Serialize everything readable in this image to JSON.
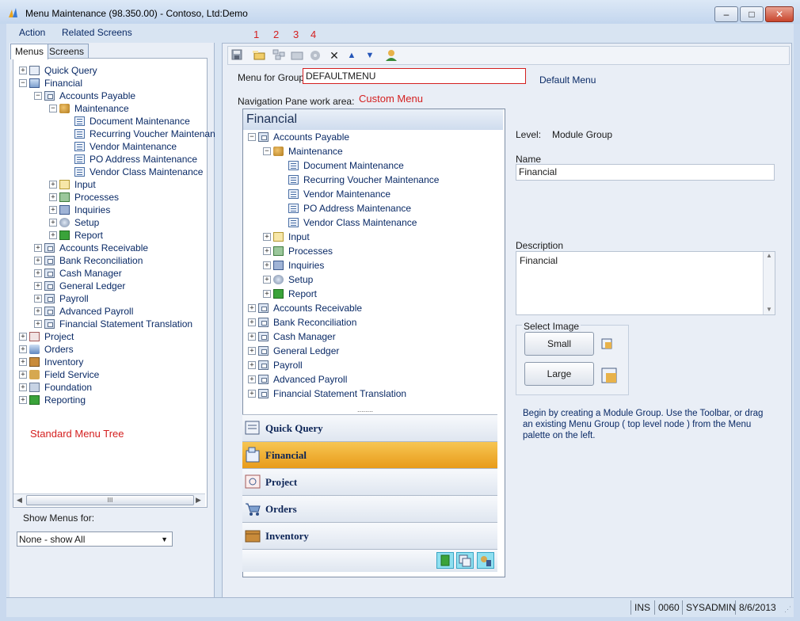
{
  "window": {
    "title": "Menu Maintenance (98.350.00) - Contoso, Ltd:Demo",
    "controls": {
      "minimize": "–",
      "maximize": "□",
      "close": "✕"
    }
  },
  "menubar": {
    "items": [
      "Action",
      "Related Screens"
    ]
  },
  "left": {
    "tabs": [
      "Menus",
      "Screens"
    ],
    "tree": [
      {
        "label": "Quick Query",
        "expander": "+"
      },
      {
        "label": "Financial",
        "expander": "−"
      },
      {
        "label": "Accounts Payable",
        "expander": "−"
      },
      {
        "label": "Maintenance",
        "expander": "−"
      },
      {
        "label": "Document Maintenance"
      },
      {
        "label": "Recurring Voucher Maintenan"
      },
      {
        "label": "Vendor Maintenance"
      },
      {
        "label": "PO Address Maintenance"
      },
      {
        "label": "Vendor Class Maintenance"
      },
      {
        "label": "Input",
        "expander": "+"
      },
      {
        "label": "Processes",
        "expander": "+"
      },
      {
        "label": "Inquiries",
        "expander": "+"
      },
      {
        "label": "Setup",
        "expander": "+"
      },
      {
        "label": "Report",
        "expander": "+"
      },
      {
        "label": "Accounts Receivable",
        "expander": "+"
      },
      {
        "label": "Bank Reconciliation",
        "expander": "+"
      },
      {
        "label": "Cash Manager",
        "expander": "+"
      },
      {
        "label": "General Ledger",
        "expander": "+"
      },
      {
        "label": "Payroll",
        "expander": "+"
      },
      {
        "label": "Advanced Payroll",
        "expander": "+"
      },
      {
        "label": "Financial Statement Translation",
        "expander": "+"
      },
      {
        "label": "Project",
        "expander": "+"
      },
      {
        "label": "Orders",
        "expander": "+"
      },
      {
        "label": "Inventory",
        "expander": "+"
      },
      {
        "label": "Field Service",
        "expander": "+"
      },
      {
        "label": "Foundation",
        "expander": "+"
      },
      {
        "label": "Reporting",
        "expander": "+"
      }
    ],
    "annotation": "Standard Menu Tree",
    "scroll_grip": "III",
    "show_menus_label": "Show Menus for:",
    "show_menus_value": "None - show All"
  },
  "toolbar": {
    "numbers": [
      "1",
      "2",
      "3",
      "4"
    ],
    "icons": [
      "save-icon",
      "new-group-icon",
      "new-menu-icon",
      "new-folder-icon",
      "copy-icon",
      "delete-icon",
      "move-up-icon",
      "move-down-icon",
      "user-icon"
    ]
  },
  "form": {
    "menu_for_group_label": "Menu for Group:",
    "menu_for_group_value": "DEFAULTMENU",
    "menu_for_group_desc": "Default Menu",
    "nav_pane_label": "Navigation Pane work area:",
    "custom_menu_annotation": "Custom Menu",
    "level_label": "Level:",
    "level_value": "Module Group",
    "name_label": "Name",
    "name_value": "Financial",
    "description_label": "Description",
    "description_value": "Financial",
    "select_image_label": "Select Image",
    "small_button": "Small",
    "large_button": "Large",
    "help_text": "Begin by creating a Module Group. Use the Toolbar, or drag an existing Menu Group ( top level node ) from the Menu palette on the left."
  },
  "nav_pane": {
    "header": "Financial",
    "tree": [
      {
        "label": "Accounts Payable",
        "expander": "−"
      },
      {
        "label": "Maintenance",
        "expander": "−"
      },
      {
        "label": "Document Maintenance"
      },
      {
        "label": "Recurring Voucher Maintenance"
      },
      {
        "label": "Vendor Maintenance"
      },
      {
        "label": "PO Address Maintenance"
      },
      {
        "label": "Vendor Class Maintenance"
      },
      {
        "label": "Input",
        "expander": "+"
      },
      {
        "label": "Processes",
        "expander": "+"
      },
      {
        "label": "Inquiries",
        "expander": "+"
      },
      {
        "label": "Setup",
        "expander": "+"
      },
      {
        "label": "Report",
        "expander": "+"
      },
      {
        "label": "Accounts Receivable",
        "expander": "+"
      },
      {
        "label": "Bank Reconciliation",
        "expander": "+"
      },
      {
        "label": "Cash Manager",
        "expander": "+"
      },
      {
        "label": "General Ledger",
        "expander": "+"
      },
      {
        "label": "Payroll",
        "expander": "+"
      },
      {
        "label": "Advanced Payroll",
        "expander": "+"
      },
      {
        "label": "Financial Statement Translation",
        "expander": "+"
      }
    ],
    "splitter": "........",
    "buttons": [
      {
        "label": "Quick Query",
        "icon": "quick-query-icon"
      },
      {
        "label": "Financial",
        "icon": "financial-icon",
        "selected": true
      },
      {
        "label": "Project",
        "icon": "project-icon"
      },
      {
        "label": "Orders",
        "icon": "orders-icon"
      },
      {
        "label": "Inventory",
        "icon": "inventory-icon"
      }
    ],
    "overflow_icons": [
      "report-icon",
      "copy-icon",
      "field-service-icon"
    ]
  },
  "statusbar": {
    "ins": "INS",
    "code": "0060",
    "user": "SYSADMIN",
    "date": "8/6/2013"
  },
  "colors": {
    "accent": "#0a2a66",
    "annotation": "#d42020",
    "selected": "#e89b1a"
  }
}
